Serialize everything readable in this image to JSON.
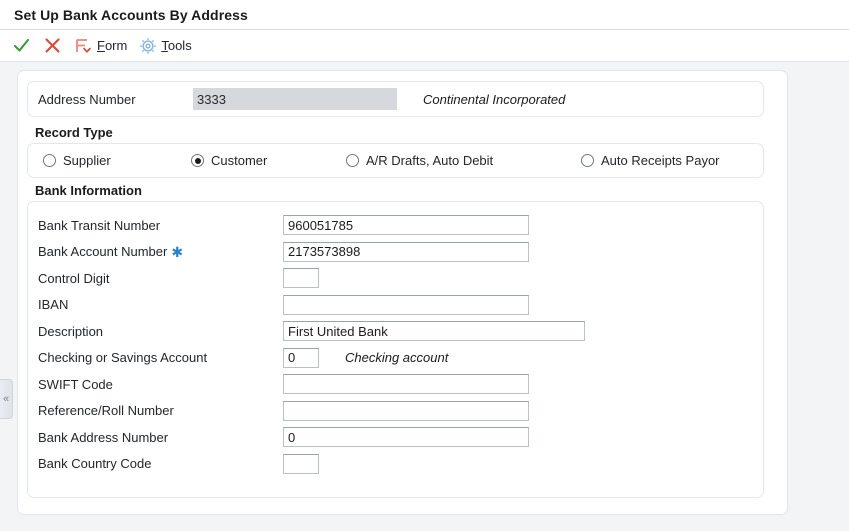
{
  "header": {
    "title": "Set Up Bank Accounts By Address"
  },
  "toolbar": {
    "items": [
      {
        "name": "ok-button",
        "icon": "check-icon",
        "label": ""
      },
      {
        "name": "cancel-button",
        "icon": "close-x-icon",
        "label": ""
      },
      {
        "name": "form-menu",
        "icon": "form-icon",
        "label": "Form",
        "accel": "F"
      },
      {
        "name": "tools-menu",
        "icon": "gear-icon",
        "label": "Tools",
        "accel": "T"
      }
    ],
    "form_label": "Form",
    "tools_label": "Tools"
  },
  "collapse_handle": {
    "glyph": "«"
  },
  "address": {
    "label": "Address Number",
    "value": "3333",
    "placeholder": "",
    "name_text": "Continental Incorporated"
  },
  "record_type": {
    "title": "Record Type",
    "options": [
      {
        "label": "Supplier",
        "selected": false
      },
      {
        "label": "Customer",
        "selected": true
      },
      {
        "label": "A/R Drafts, Auto Debit",
        "selected": false
      },
      {
        "label": "Auto Receipts Payor",
        "selected": false
      }
    ]
  },
  "bank_information": {
    "title": "Bank Information",
    "fields": [
      {
        "label": "Bank Transit Number",
        "value": "960051785",
        "required": false,
        "width": "std",
        "suffix": ""
      },
      {
        "label": "Bank Account Number",
        "value": "2173573898",
        "required": true,
        "width": "std",
        "suffix": ""
      },
      {
        "label": "Control Digit",
        "value": "",
        "required": false,
        "width": "tiny",
        "suffix": ""
      },
      {
        "label": "IBAN",
        "value": "",
        "required": false,
        "width": "std",
        "suffix": ""
      },
      {
        "label": "Description",
        "value": "First United Bank",
        "required": false,
        "width": "desc",
        "suffix": ""
      },
      {
        "label": "Checking or Savings Account",
        "value": "0",
        "required": false,
        "width": "tiny",
        "suffix": "Checking account"
      },
      {
        "label": "SWIFT Code",
        "value": "",
        "required": false,
        "width": "std",
        "suffix": ""
      },
      {
        "label": "Reference/Roll Number",
        "value": "",
        "required": false,
        "width": "std",
        "suffix": ""
      },
      {
        "label": "Bank Address Number",
        "value": "0",
        "required": false,
        "width": "std",
        "suffix": ""
      },
      {
        "label": "Bank Country Code",
        "value": "",
        "required": false,
        "width": "tiny",
        "suffix": ""
      }
    ],
    "required_marker": "✱"
  },
  "colors": {
    "accent_blue": "#2a7fc9",
    "ok_green": "#3a9b3a",
    "cancel_red": "#d94a3d",
    "form_red": "#e8897f",
    "gear_blue": "#8ab8dd",
    "body_bg": "#f3f4f6",
    "readonly_bg": "#d5d8dc"
  }
}
